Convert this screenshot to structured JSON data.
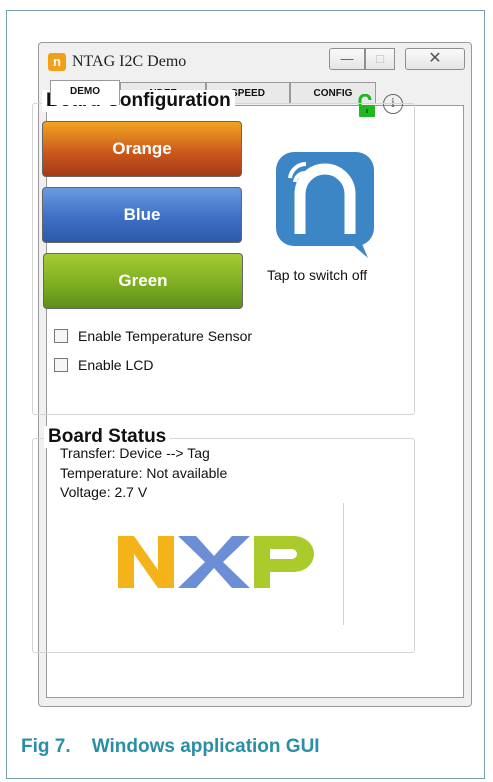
{
  "window": {
    "title": "NTAG I2C Demo",
    "app_icon": "n",
    "controls": {
      "minimize": "—",
      "maximize": "□",
      "close": "✕"
    }
  },
  "tabs": [
    {
      "label": "DEMO",
      "active": true
    },
    {
      "label": "NDEF",
      "active": false
    },
    {
      "label": "SPEED",
      "active": false
    },
    {
      "label": "CONFIG",
      "active": false
    }
  ],
  "icons": {
    "lock": "unlocked-padlock",
    "info": "i"
  },
  "board_configuration": {
    "title": "Board Configuration",
    "buttons": [
      {
        "label": "Orange",
        "color": "#c9551a"
      },
      {
        "label": "Blue",
        "color": "#3d6fc6"
      },
      {
        "label": "Green",
        "color": "#7fae22"
      }
    ],
    "nfc_hint": "Tap to switch off",
    "checkboxes": [
      {
        "label": "Enable Temperature Sensor",
        "checked": false
      },
      {
        "label": "Enable LCD",
        "checked": false
      }
    ]
  },
  "board_status": {
    "title": "Board Status",
    "transfer": "Transfer: Device --> Tag",
    "temperature": "Temperature: Not available",
    "voltage": "Voltage: 2.7 V"
  },
  "caption": "Fig 7.    Windows application GUI",
  "colors": {
    "nfc_blue": "#3d86c6",
    "lock_green": "#1fb81f",
    "caption": "#2a8fa6"
  }
}
